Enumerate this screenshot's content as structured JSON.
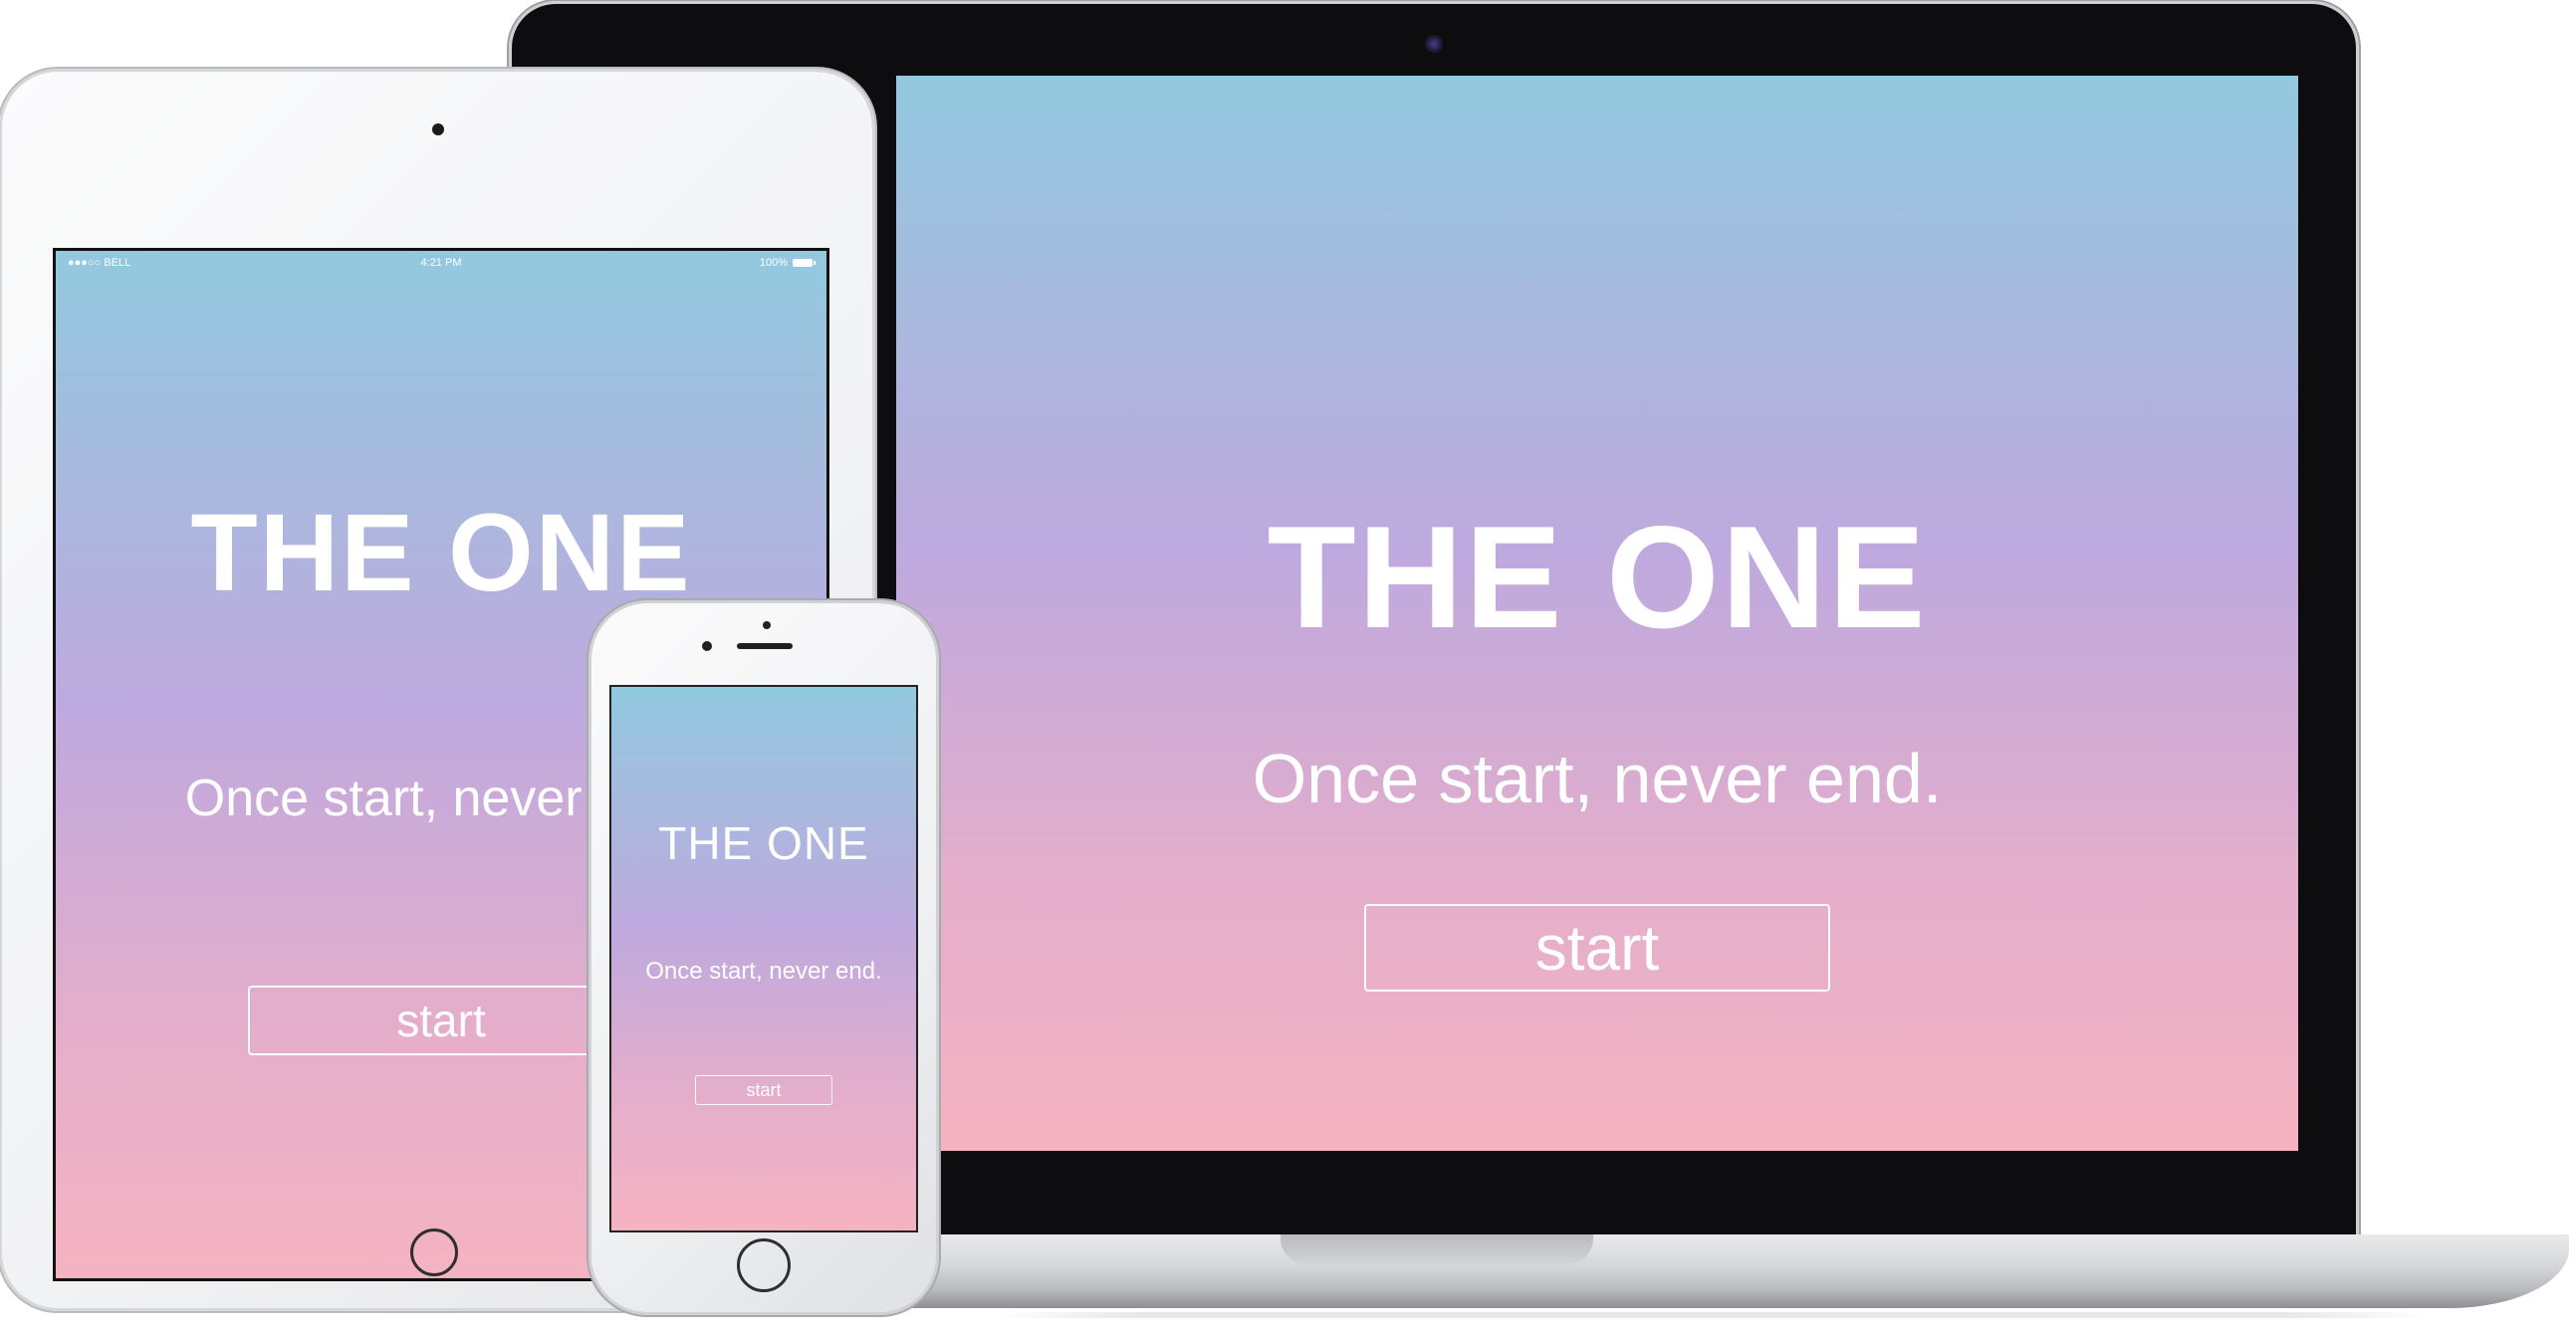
{
  "app": {
    "title": "THE ONE",
    "tagline": "Once start, never end.",
    "start_label": "start"
  },
  "tablet_status_bar": {
    "carrier": "●●●○○ BELL",
    "time": "4:21 PM",
    "battery": "100%"
  },
  "colors": {
    "gradient_top": "#92c9df",
    "gradient_mid": "#bfa9de",
    "gradient_bottom": "#f5b3c1",
    "text": "#ffffff"
  }
}
